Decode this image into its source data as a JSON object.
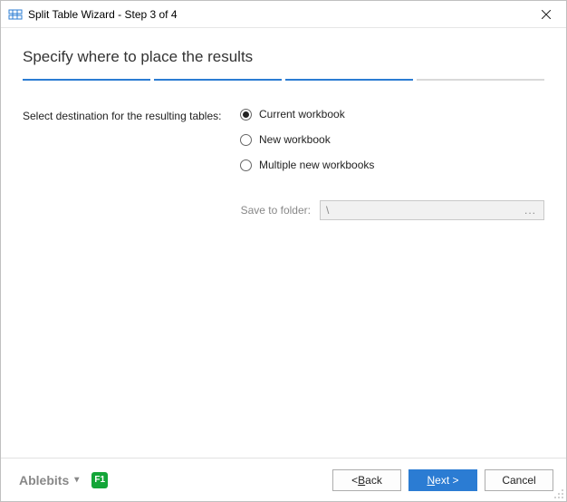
{
  "titlebar": {
    "title": "Split Table Wizard - Step 3 of 4"
  },
  "heading": "Specify where to place the results",
  "steps": {
    "total": 4,
    "current": 3
  },
  "form": {
    "destination_label": "Select destination for the resulting tables:",
    "options": {
      "current_workbook": "Current workbook",
      "new_workbook": "New workbook",
      "multiple_new_workbooks": "Multiple new workbooks"
    },
    "selected": "current_workbook",
    "save_folder": {
      "label": "Save to folder:",
      "value": "\\",
      "browse": "...",
      "enabled": false
    }
  },
  "footer": {
    "brand": "Ablebits",
    "help": "F1",
    "buttons": {
      "back_prefix": "< ",
      "back_u": "B",
      "back_suffix": "ack",
      "next_u": "N",
      "next_suffix": "ext >",
      "cancel": "Cancel"
    }
  }
}
